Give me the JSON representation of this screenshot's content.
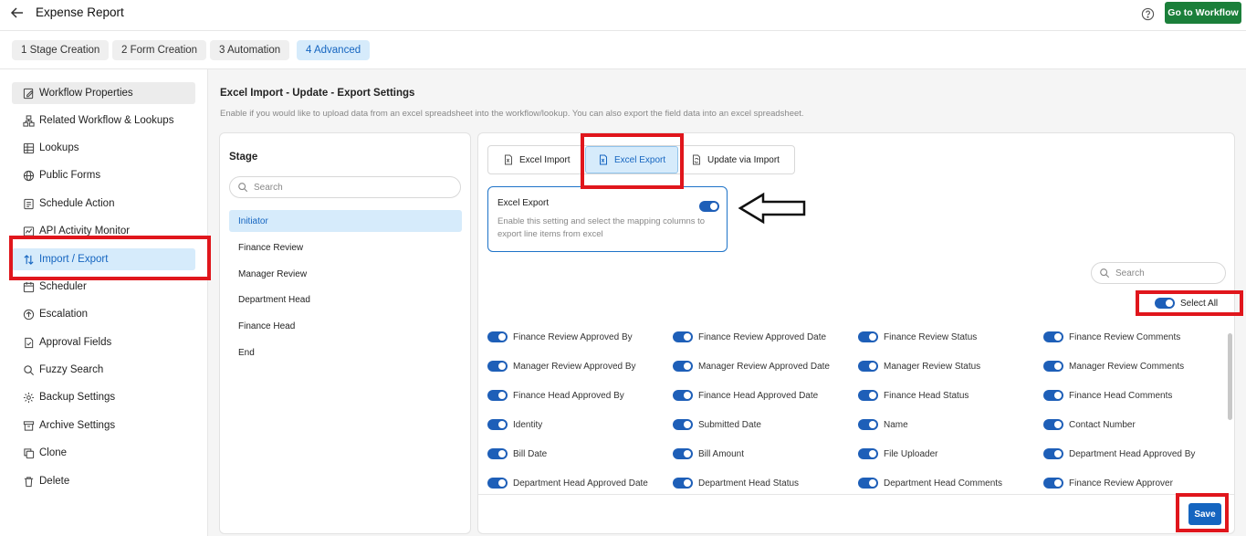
{
  "header": {
    "title": "Expense Report",
    "goto_label": "Go to Workflow"
  },
  "steps": [
    {
      "label": "1  Stage Creation"
    },
    {
      "label": "2  Form Creation"
    },
    {
      "label": "3  Automation"
    },
    {
      "label": "4  Advanced"
    }
  ],
  "sidebar": {
    "items": [
      {
        "label": "Workflow Properties",
        "icon": "edit-doc-icon"
      },
      {
        "label": "Related Workflow & Lookups",
        "icon": "hierarchy-icon"
      },
      {
        "label": "Lookups",
        "icon": "table-icon"
      },
      {
        "label": "Public Forms",
        "icon": "globe-icon"
      },
      {
        "label": "Schedule Action",
        "icon": "schedule-doc-icon"
      },
      {
        "label": "API Activity Monitor",
        "icon": "api-icon"
      },
      {
        "label": "Import / Export",
        "icon": "import-export-icon"
      },
      {
        "label": "Scheduler",
        "icon": "calendar-icon"
      },
      {
        "label": "Escalation",
        "icon": "escalation-icon"
      },
      {
        "label": "Approval Fields",
        "icon": "approval-doc-icon"
      },
      {
        "label": "Fuzzy Search",
        "icon": "search-icon"
      },
      {
        "label": "Backup Settings",
        "icon": "gear-icon"
      },
      {
        "label": "Archive Settings",
        "icon": "archive-icon"
      },
      {
        "label": "Clone",
        "icon": "copy-icon"
      },
      {
        "label": "Delete",
        "icon": "trash-icon"
      }
    ]
  },
  "section": {
    "title": "Excel Import - Update - Export Settings",
    "description": "Enable if you would like to upload data from an excel spreadsheet into the workflow/lookup. You can also export the field data into an excel spreadsheet."
  },
  "stage_panel": {
    "title": "Stage",
    "search_placeholder": "Search",
    "stages": [
      "Initiator",
      "Finance Review",
      "Manager Review",
      "Department Head",
      "Finance Head",
      "End"
    ]
  },
  "tabs": [
    {
      "label": "Excel Import"
    },
    {
      "label": "Excel Export"
    },
    {
      "label": "Update via Import"
    }
  ],
  "export_card": {
    "title": "Excel Export",
    "description": "Enable this setting and select the mapping columns to export line items from excel",
    "enabled": true
  },
  "fields_search_placeholder": "Search",
  "select_all_label": "Select All",
  "fields": [
    "Finance Review Approved By",
    "Finance Review Approved Date",
    "Finance Review Status",
    "Finance Review Comments",
    "Manager Review Approved By",
    "Manager Review Approved Date",
    "Manager Review Status",
    "Manager Review Comments",
    "Finance Head Approved By",
    "Finance Head Approved Date",
    "Finance Head Status",
    "Finance Head Comments",
    "Identity",
    "Submitted Date",
    "Name",
    "Contact Number",
    "Bill Date",
    "Bill Amount",
    "File Uploader",
    "Department Head Approved By",
    "Department Head Approved Date",
    "Department Head Status",
    "Department Head Comments",
    "Finance Review Approver"
  ],
  "save_label": "Save",
  "colors": {
    "accent": "#1565c0",
    "active_bg": "#d6ebfb",
    "goto_green": "#1b7f3a",
    "annotation_red": "#e0161c"
  }
}
